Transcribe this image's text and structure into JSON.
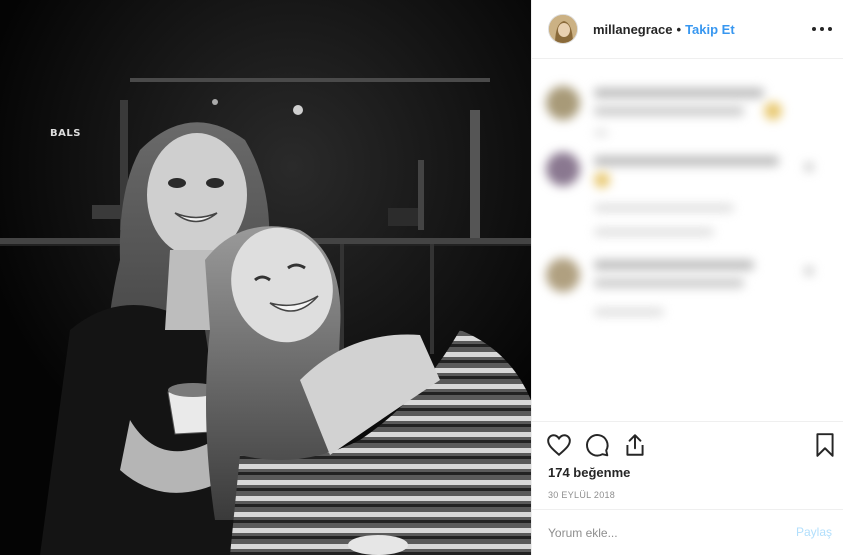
{
  "post": {
    "author": "millanegrace",
    "separator": "•",
    "follow_label": "Takip Et",
    "photo_sign": "BALS"
  },
  "actions": {
    "icons": [
      "heart-icon",
      "comment-icon",
      "share-icon",
      "bookmark-icon"
    ],
    "likes": "174 beğenme",
    "date": "30 EYLÜL 2018"
  },
  "comment_box": {
    "placeholder": "Yorum ekle...",
    "share_label": "Paylaş"
  },
  "colors": {
    "accent": "#3897f0",
    "text": "#262626",
    "muted": "#8e8e8e",
    "share_disabled": "#b2dffc"
  }
}
